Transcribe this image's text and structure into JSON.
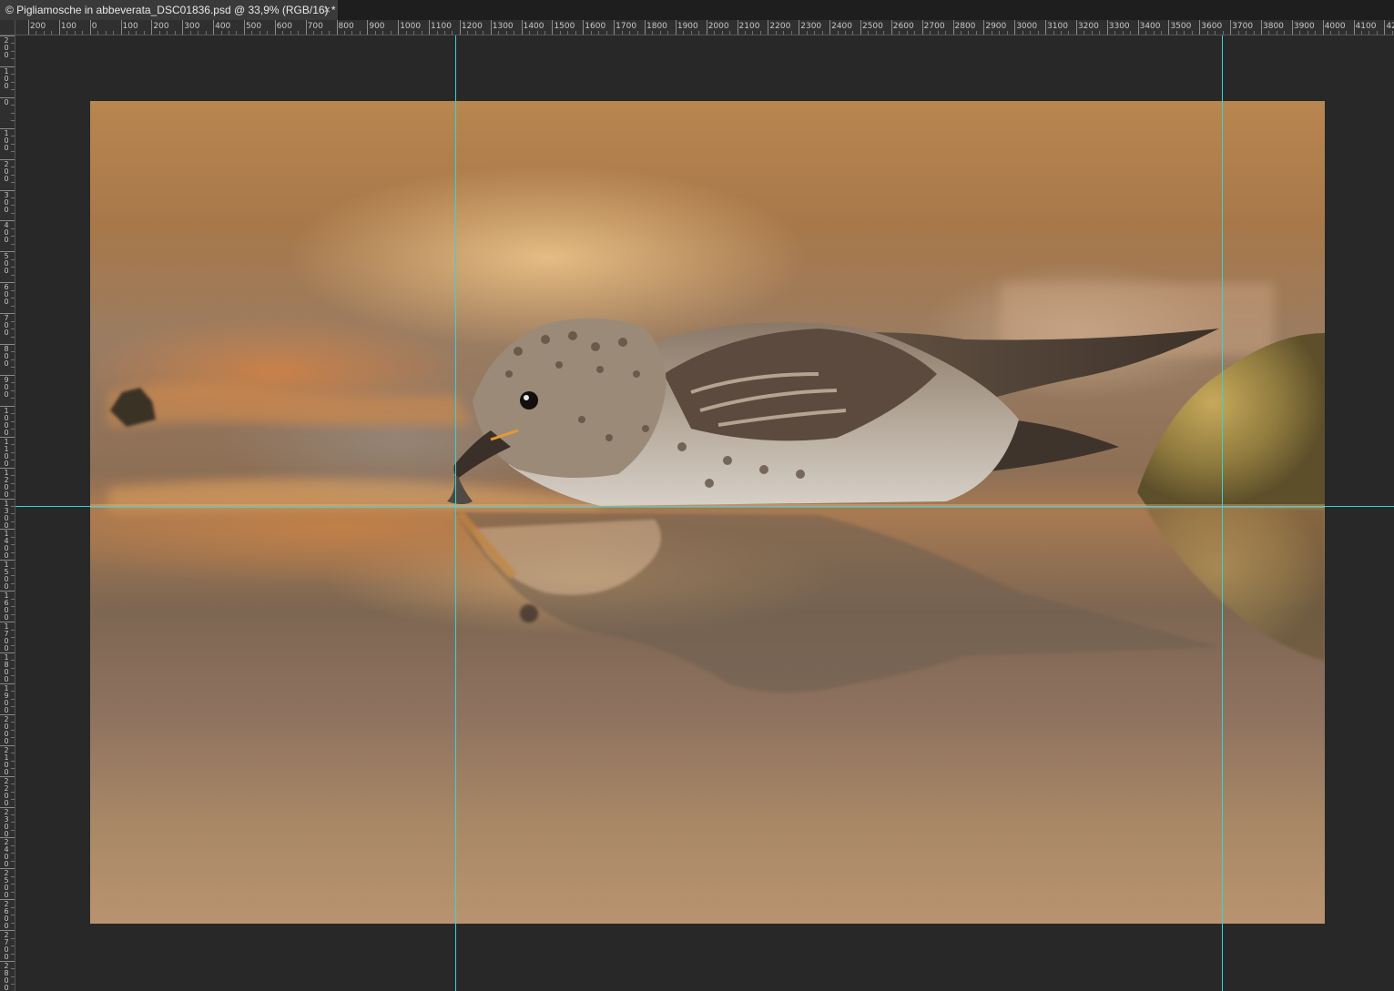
{
  "document": {
    "tab_title": "© Pigliamosche in abbeverata_DSC01836.psd @ 33,9% (RGB/16) *",
    "close_glyph": "×"
  },
  "ruler_horizontal": {
    "labels": [
      "200",
      "100",
      "0",
      "100",
      "200",
      "300",
      "400",
      "500",
      "600",
      "700",
      "800",
      "900",
      "1000",
      "1100",
      "1200",
      "1300",
      "1400",
      "1500",
      "1600",
      "1700",
      "1800",
      "1900",
      "2000",
      "2100",
      "2200",
      "2300",
      "2400",
      "2500",
      "2600",
      "2700",
      "2800",
      "2900",
      "3000",
      "3100",
      "3200",
      "3300",
      "3400",
      "3500",
      "3600",
      "3700",
      "3800",
      "3900",
      "4000",
      "4100",
      "42"
    ]
  },
  "ruler_vertical": {
    "labels": [
      "200",
      "100",
      "0",
      "100",
      "200",
      "300",
      "400",
      "500",
      "600",
      "700",
      "800",
      "900",
      "1000",
      "1100",
      "1200",
      "1300",
      "1400",
      "1500",
      "1600",
      "1700",
      "1800",
      "1900",
      "2000",
      "2100",
      "2200",
      "2300",
      "2400",
      "2500",
      "2600",
      "2700",
      "2800",
      "2900"
    ]
  },
  "colors": {
    "guide": "#33d6d6",
    "pasteboard": "#282828",
    "ruler_bg": "#2f2f2f"
  },
  "image": {
    "subject": "spotted flycatcher drinking water with reflection"
  }
}
